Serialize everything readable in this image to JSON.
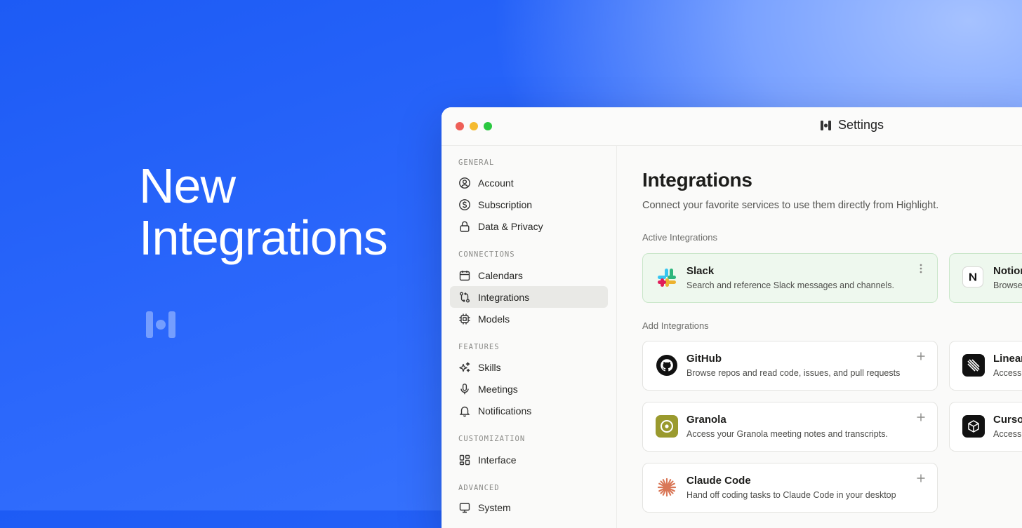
{
  "hero": {
    "line1": "New",
    "line2": "Integrations"
  },
  "window": {
    "title": "Settings"
  },
  "sidebar": {
    "general_label": "GENERAL",
    "connections_label": "CONNECTIONS",
    "features_label": "FEATURES",
    "customization_label": "CUSTOMIZATION",
    "advanced_label": "ADVANCED",
    "items": {
      "account": "Account",
      "subscription": "Subscription",
      "privacy": "Data & Privacy",
      "calendars": "Calendars",
      "integrations": "Integrations",
      "models": "Models",
      "skills": "Skills",
      "meetings": "Meetings",
      "notifications": "Notifications",
      "interface": "Interface",
      "system": "System"
    },
    "active_item": "Integrations"
  },
  "main": {
    "title": "Integrations",
    "subtitle": "Connect your favorite services to use them directly from Highlight.",
    "active_label": "Active Integrations",
    "add_label": "Add Integrations",
    "active": [
      {
        "name": "Slack",
        "desc": "Search and reference Slack messages and channels.",
        "icon": "slack-icon"
      },
      {
        "name": "Notion",
        "desc": "Browse",
        "icon": "notion-icon"
      }
    ],
    "available": [
      {
        "name": "GitHub",
        "desc": "Browse repos and read code, issues, and pull requests",
        "icon": "github-icon"
      },
      {
        "name": "Linear",
        "desc": "Access",
        "icon": "linear-icon"
      },
      {
        "name": "Granola",
        "desc": "Access your Granola meeting notes and transcripts.",
        "icon": "granola-icon"
      },
      {
        "name": "Cursor",
        "desc": "Access",
        "icon": "cursor-icon"
      },
      {
        "name": "Claude Code",
        "desc": "Hand off coding tasks to Claude Code in your desktop",
        "icon": "claude-icon"
      }
    ]
  },
  "colors": {
    "background_start": "#1d5bf5",
    "background_end": "#a6c2ff",
    "active_card_bg": "#eef8ee",
    "granola_bg": "#9a9a2e",
    "claude_orange": "#d97757"
  }
}
